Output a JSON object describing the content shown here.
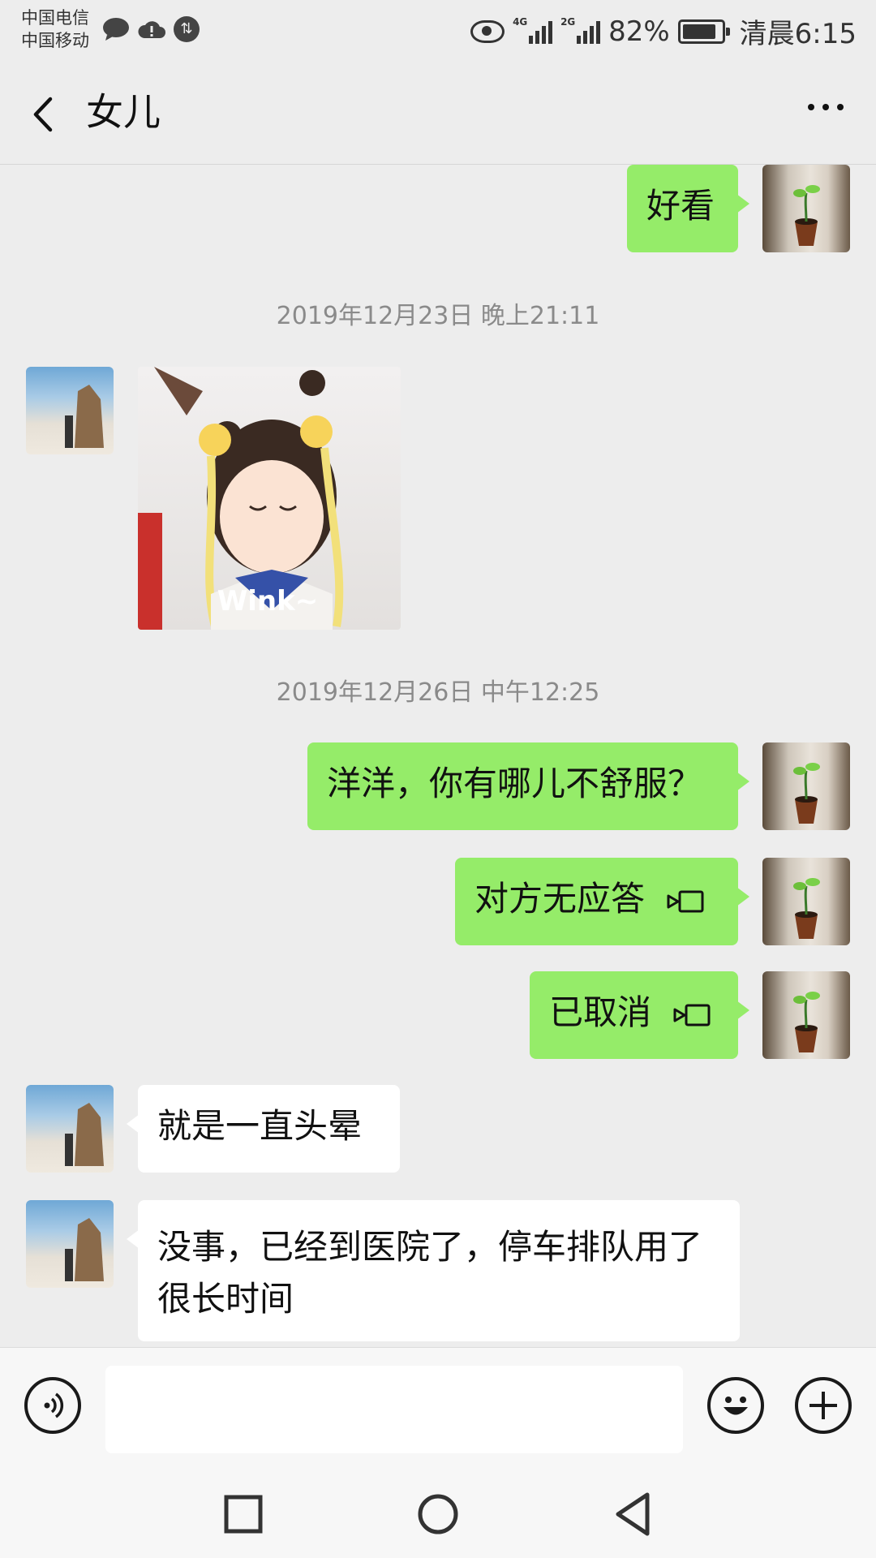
{
  "status_bar": {
    "carrier_1": "中国电信",
    "carrier_2": "中国移动",
    "net_1": "4G",
    "net_2": "2G",
    "battery": "82%",
    "time": "清晨6:15"
  },
  "header": {
    "title": "女儿"
  },
  "messages": [
    {
      "side": "me",
      "text": "好看"
    },
    {
      "timestamp": "2019年12月23日 晚上21:11"
    },
    {
      "side": "her",
      "type": "sticker",
      "sticker_text": "Wink~"
    },
    {
      "timestamp": "2019年12月26日 中午12:25"
    },
    {
      "side": "me",
      "text": "洋洋，你有哪儿不舒服？"
    },
    {
      "side": "me",
      "text": "对方无应答",
      "icon": "video-call-icon"
    },
    {
      "side": "me",
      "text": "已取消",
      "icon": "video-call-icon"
    },
    {
      "side": "her",
      "text": "就是一直头晕"
    },
    {
      "side": "her",
      "text": "没事，已经到医院了，停车排队用了很长时间"
    }
  ],
  "colors": {
    "my_bubble": "#95ec69",
    "their_bubble": "#ffffff",
    "background": "#ededed"
  }
}
